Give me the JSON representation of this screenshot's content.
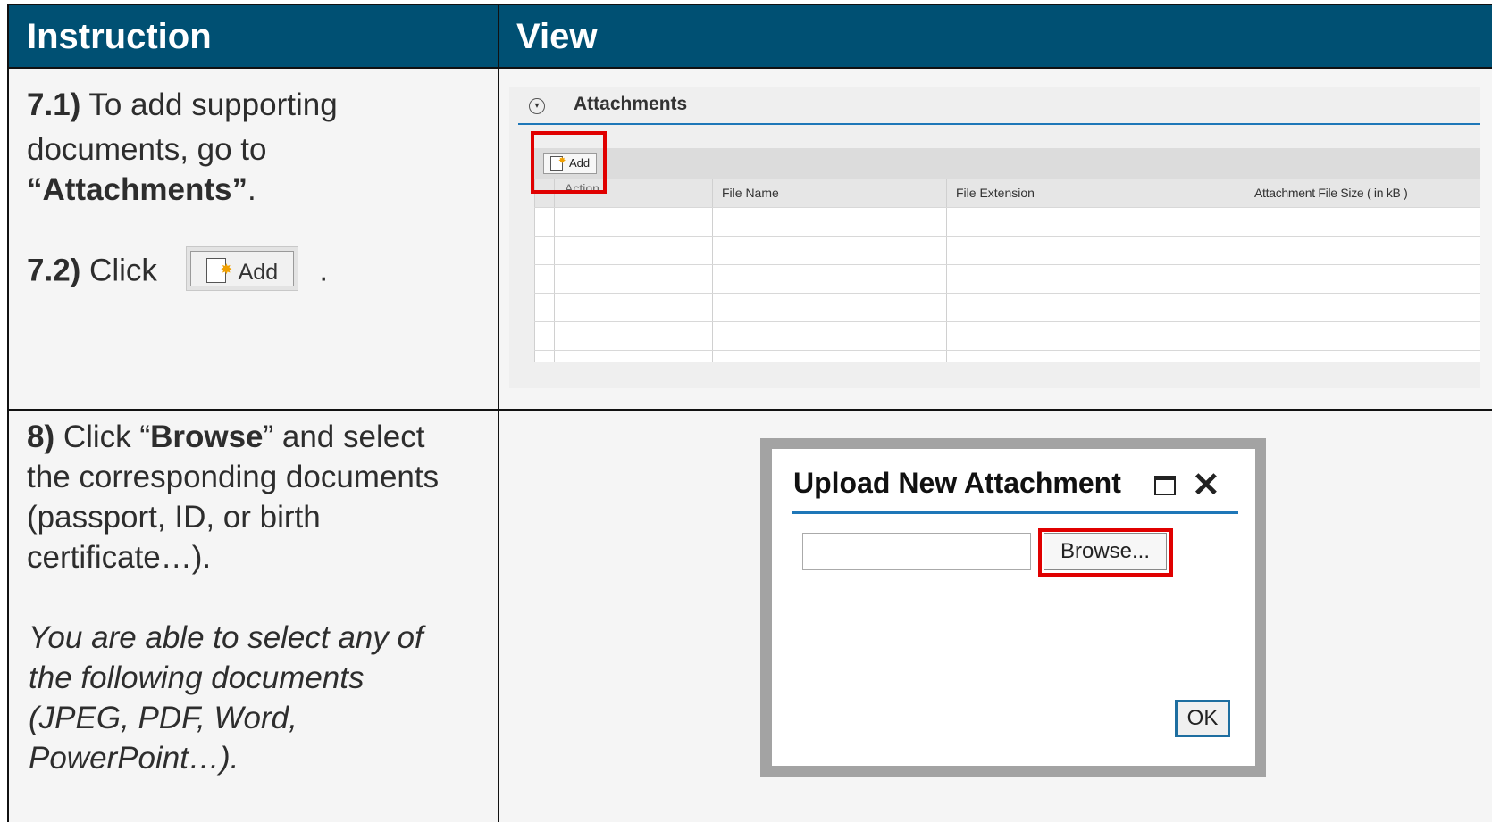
{
  "headers": {
    "instruction": "Instruction",
    "view": "View"
  },
  "row1": {
    "step71_num": "7.1)",
    "step71_text1": " To add supporting",
    "step71_text2": "documents, go to",
    "step71_attachments": "“Attachments”",
    "step71_period": ".",
    "step72_num": "7.2)",
    "step72_click": " Click",
    "step72_button_label": "Add",
    "step72_period": "."
  },
  "row2": {
    "step8_num": "8)",
    "step8_click": " Click “",
    "step8_browse": "Browse",
    "step8_rest1": "” and select",
    "step8_rest2": "the corresponding documents",
    "step8_rest3": "(passport, ID, or birth",
    "step8_rest4": "certificate…).",
    "note1": "You are able to select any of",
    "note2": "the following documents",
    "note3": "(JPEG, PDF, Word,",
    "note4": "PowerPoint…)."
  },
  "attachments_panel": {
    "title": "Attachments",
    "add_button": "Add",
    "columns": [
      "Action",
      "File Name",
      "File Extension",
      "Attachment File Size ( in kB )"
    ],
    "rows": [
      [
        "",
        "",
        "",
        ""
      ],
      [
        "",
        "",
        "",
        ""
      ],
      [
        "",
        "",
        "",
        ""
      ],
      [
        "",
        "",
        "",
        ""
      ],
      [
        "",
        "",
        "",
        ""
      ]
    ]
  },
  "upload_dialog": {
    "title": "Upload New Attachment",
    "file_value": "",
    "browse_label": "Browse...",
    "ok_label": "OK"
  },
  "colors": {
    "header_bg": "#005073",
    "highlight": "#e00000",
    "accent_line": "#1e77b8"
  },
  "icons": [
    "document-add-icon",
    "collapse-toggle-icon",
    "maximize-icon",
    "close-icon"
  ]
}
